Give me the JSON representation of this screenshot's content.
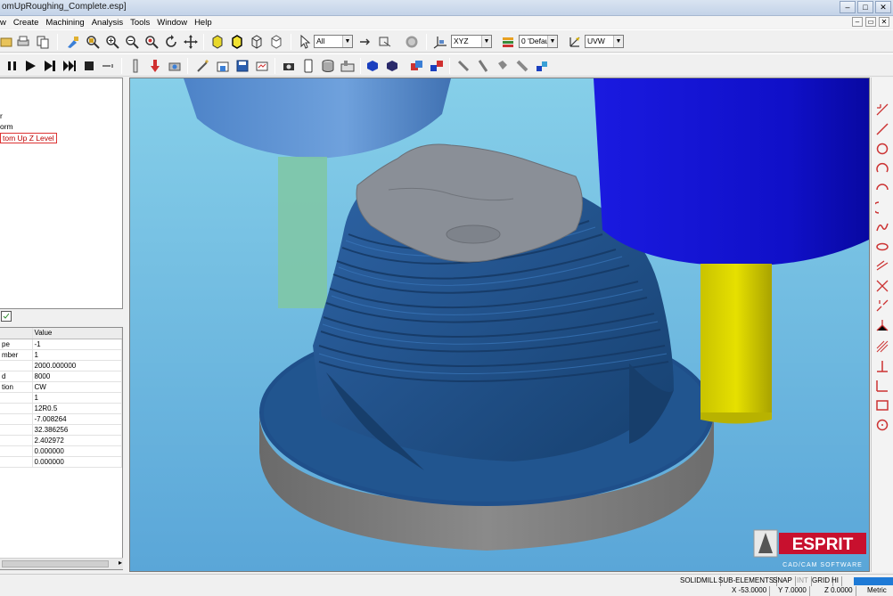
{
  "window": {
    "title": "omUpRoughing_Complete.esp]",
    "buttons": [
      "–",
      "□",
      "✕"
    ]
  },
  "menu": [
    "w",
    "Create",
    "Machining",
    "Analysis",
    "Tools",
    "Window",
    "Help"
  ],
  "mdi_buttons": [
    "–",
    "▭",
    "✕"
  ],
  "toolbar": {
    "filter_combo": "All",
    "plane_combo": "XYZ",
    "layer_combo": "0 'Defau",
    "workplane_combo": "UVW"
  },
  "tree": {
    "items": [
      "r",
      "orm",
      "tom Up Z Level"
    ]
  },
  "properties": {
    "header": [
      "",
      "Value"
    ],
    "rows": [
      [
        "pe",
        "-1"
      ],
      [
        "mber",
        "1"
      ],
      [
        "",
        "2000.000000"
      ],
      [
        "d",
        "8000"
      ],
      [
        "tion",
        "CW"
      ],
      [
        "",
        "1"
      ],
      [
        "",
        "12R0.5"
      ],
      [
        "",
        "-7.008264"
      ],
      [
        "",
        "32.386256"
      ],
      [
        "",
        "2.402972"
      ],
      [
        "",
        "0.000000"
      ],
      [
        "",
        "0.000000"
      ]
    ]
  },
  "logo": {
    "brand": "ESPRIT",
    "tagline": "CAD/CAM SOFTWARE"
  },
  "status": {
    "modes": [
      "SOLIDMILL",
      "SUB-ELEMENTS",
      "SNAP",
      "INT",
      "GRID",
      "HI"
    ],
    "x": "X -53.0000",
    "y": "Y 7.0000",
    "z": "Z 0.0000",
    "units": "Metric"
  },
  "colors": {
    "viewport_bg": "#7ec8e6",
    "stock_blue": "#1f4f8a",
    "base_gray": "#7d7d7d",
    "tool_holder_blue": "#1515d6",
    "tool_yellow": "#d9d400",
    "brand_red": "#c8102e"
  }
}
